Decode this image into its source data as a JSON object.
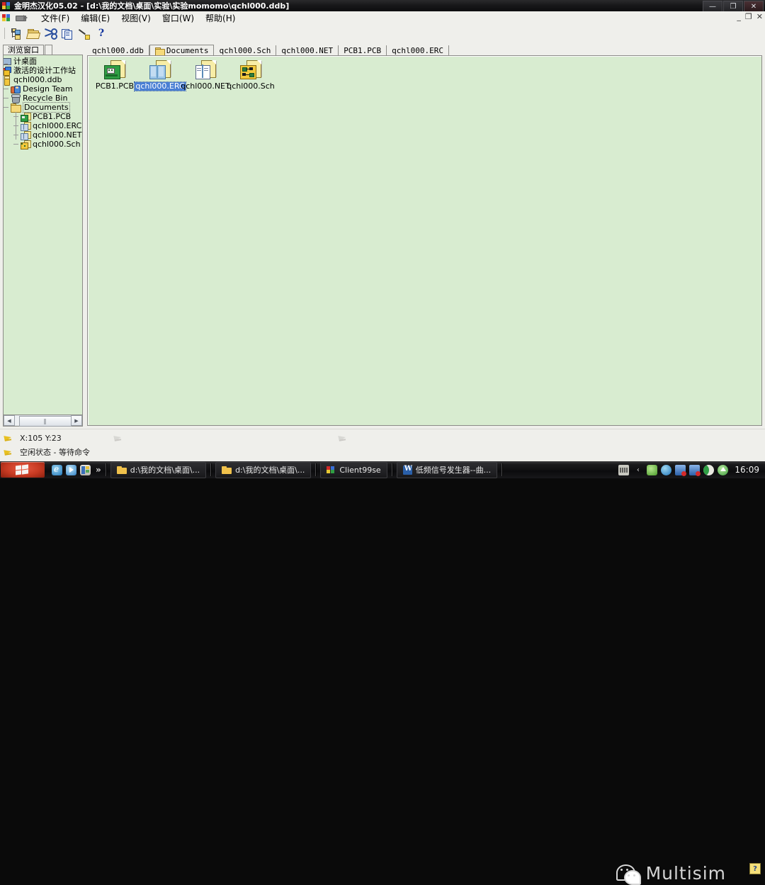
{
  "window": {
    "title": "金明杰汉化05.02 - [d:\\我的文档\\桌面\\实验\\实验momomo\\qchl000.ddb]",
    "app_icon": "protel-logo-icon",
    "controls": {
      "minimize": "—",
      "maximize": "❐",
      "close": "✕"
    },
    "mdi_controls": {
      "minimize": "_",
      "restore": "❐",
      "close": "✕"
    }
  },
  "menubar": {
    "items": [
      {
        "name": "file",
        "label": "文件(F)",
        "accel": "F"
      },
      {
        "name": "edit",
        "label": "编辑(E)",
        "accel": "E"
      },
      {
        "name": "view",
        "label": "视图(V)",
        "accel": "V"
      },
      {
        "name": "window",
        "label": "窗口(W)",
        "accel": "W"
      },
      {
        "name": "help",
        "label": "帮助(H)",
        "accel": "H"
      }
    ]
  },
  "toolbar": {
    "buttons": [
      {
        "name": "browse-tree-button",
        "icon": "tree-icon",
        "title": "浏览"
      },
      {
        "name": "open-button",
        "icon": "open-folder-icon",
        "title": "打开"
      },
      {
        "name": "cut-button",
        "icon": "scissors-icon",
        "title": "剪切"
      },
      {
        "name": "copy-button",
        "icon": "copy-icon",
        "title": "复制"
      },
      {
        "name": "paste-button",
        "icon": "paste-icon",
        "title": "粘贴"
      },
      {
        "name": "help-button",
        "icon": "question-mark-icon",
        "label": "?"
      }
    ]
  },
  "sidebar": {
    "tab_label": "浏览窗口",
    "tree": [
      {
        "label": "计桌面",
        "icon": "desktop-icon",
        "indent": 0,
        "name": "tree-item-desktop"
      },
      {
        "label": "激活的设计工作站",
        "icon": "workstation-icon",
        "indent": 0,
        "name": "tree-item-workstation"
      },
      {
        "label": "qchl000.ddb",
        "icon": "ddb-icon",
        "indent": 0,
        "name": "tree-item-ddb"
      },
      {
        "label": "Design Team",
        "icon": "team-icon",
        "indent": 1,
        "name": "tree-item-design-team"
      },
      {
        "label": "Recycle Bin",
        "icon": "recycle-bin-icon",
        "indent": 1,
        "name": "tree-item-recycle-bin"
      },
      {
        "label": "Documents",
        "icon": "folder-icon",
        "indent": 1,
        "name": "tree-item-documents",
        "selected": true
      },
      {
        "label": "PCB1.PCB",
        "icon": "pcb-icon",
        "indent": 2,
        "name": "tree-item-pcb1"
      },
      {
        "label": "qchl000.ERC",
        "icon": "erc-icon",
        "indent": 2,
        "name": "tree-item-erc"
      },
      {
        "label": "qchl000.NET",
        "icon": "net-icon",
        "indent": 2,
        "name": "tree-item-net"
      },
      {
        "label": "qchl000.Sch",
        "icon": "sch-icon",
        "indent": 2,
        "name": "tree-item-sch"
      }
    ],
    "hscroll": {
      "left_arrow": "◀",
      "right_arrow": "▶",
      "grip": "‖"
    }
  },
  "document_tabs": [
    {
      "label": "qchl000.ddb",
      "name": "doc-tab-ddb",
      "active": false,
      "icon": null
    },
    {
      "label": "Documents",
      "name": "doc-tab-documents",
      "active": true,
      "icon": "folder-icon"
    },
    {
      "label": "qchl000.Sch",
      "name": "doc-tab-sch",
      "active": false,
      "icon": null
    },
    {
      "label": "qchl000.NET",
      "name": "doc-tab-net",
      "active": false,
      "icon": null
    },
    {
      "label": "PCB1.PCB",
      "name": "doc-tab-pcb",
      "active": false,
      "icon": null
    },
    {
      "label": "qchl000.ERC",
      "name": "doc-tab-erc",
      "active": false,
      "icon": null
    }
  ],
  "files": [
    {
      "label": "PCB1.PCB",
      "icon": "pcb-file-icon",
      "selected": false,
      "name": "file-item-pcb1"
    },
    {
      "label": "qchl000.ERC",
      "icon": "erc-file-icon",
      "selected": true,
      "name": "file-item-erc"
    },
    {
      "label": "qchl000.NET",
      "icon": "net-file-icon",
      "selected": false,
      "name": "file-item-net"
    },
    {
      "label": "qchl000.Sch",
      "icon": "sch-file-icon",
      "selected": false,
      "name": "file-item-sch"
    }
  ],
  "statusbar": {
    "coordinates": "X:105  Y:23",
    "state": "空闲状态   -  等待命令",
    "cursor_icon": "yellow-arrow-icon"
  },
  "watermark": {
    "logo": "wechat-icon",
    "text": "Multisim",
    "help_badge": "?"
  },
  "taskbar": {
    "start_icon": "windows-flag-icon",
    "quicklaunch": [
      {
        "name": "ql-ie-icon",
        "icon": "internet-explorer-icon"
      },
      {
        "name": "ql-media-icon",
        "icon": "media-player-icon"
      },
      {
        "name": "ql-showdesktop-icon",
        "icon": "show-desktop-icon"
      },
      {
        "name": "ql-more-button",
        "icon": "chevron-right-icon",
        "label": "»"
      }
    ],
    "tasks": [
      {
        "label": "d:\\我的文档\\桌面\\...",
        "icon": "folder-icon",
        "name": "taskbar-item-explorer-1"
      },
      {
        "label": "d:\\我的文档\\桌面\\...",
        "icon": "folder-icon",
        "name": "taskbar-item-explorer-2"
      },
      {
        "label": "Client99se",
        "icon": "protel-logo-icon",
        "name": "taskbar-item-client99se"
      },
      {
        "label": "低频信号发生器--曲...",
        "icon": "word-icon",
        "name": "taskbar-item-word"
      }
    ],
    "tray": [
      {
        "name": "tray-keyboard-icon",
        "icon": "keyboard-icon"
      },
      {
        "name": "tray-expand-icon",
        "icon": "chevron-left-icon",
        "label": "‹"
      },
      {
        "name": "tray-green-icon",
        "icon": "leaf-icon"
      },
      {
        "name": "tray-globe-icon",
        "icon": "globe-icon"
      },
      {
        "name": "tray-network1-icon",
        "icon": "network-error-icon"
      },
      {
        "name": "tray-network2-icon",
        "icon": "network-error-icon"
      },
      {
        "name": "tray-moon-icon",
        "icon": "crescent-icon"
      },
      {
        "name": "tray-upload-icon",
        "icon": "upload-arrow-icon"
      }
    ],
    "clock": "16:09"
  }
}
